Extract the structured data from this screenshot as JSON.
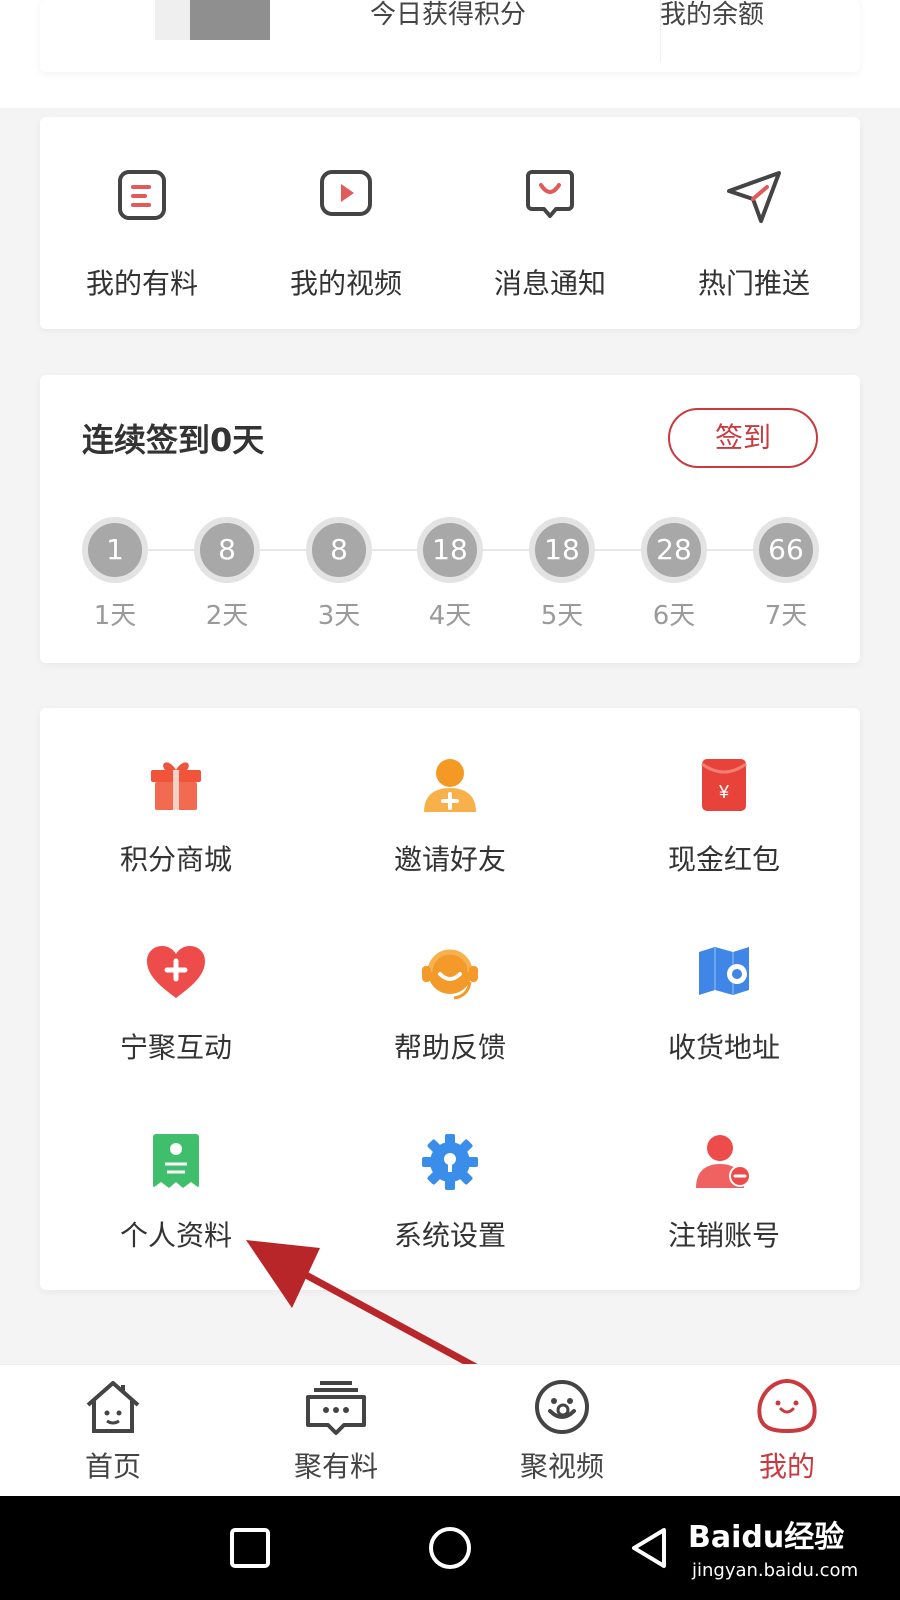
{
  "header": {
    "points_label": "今日获得积分",
    "balance_label": "我的余额"
  },
  "quick_actions": [
    {
      "label": "我的有料",
      "icon": "note-icon"
    },
    {
      "label": "我的视频",
      "icon": "video-play-icon"
    },
    {
      "label": "消息通知",
      "icon": "message-bubble-icon"
    },
    {
      "label": "热门推送",
      "icon": "paper-plane-icon"
    }
  ],
  "signin": {
    "title": "连续签到0天",
    "button_label": "签到",
    "days": [
      {
        "points": "1",
        "label": "1天"
      },
      {
        "points": "8",
        "label": "2天"
      },
      {
        "points": "8",
        "label": "3天"
      },
      {
        "points": "18",
        "label": "4天"
      },
      {
        "points": "18",
        "label": "5天"
      },
      {
        "points": "28",
        "label": "6天"
      },
      {
        "points": "66",
        "label": "7天"
      }
    ]
  },
  "services": [
    {
      "label": "积分商城",
      "icon": "gift-icon"
    },
    {
      "label": "邀请好友",
      "icon": "add-user-icon"
    },
    {
      "label": "现金红包",
      "icon": "red-envelope-icon"
    },
    {
      "label": "宁聚互动",
      "icon": "heart-plus-icon"
    },
    {
      "label": "帮助反馈",
      "icon": "headset-icon"
    },
    {
      "label": "收货地址",
      "icon": "map-pin-icon"
    },
    {
      "label": "个人资料",
      "icon": "profile-card-icon"
    },
    {
      "label": "系统设置",
      "icon": "settings-gear-icon"
    },
    {
      "label": "注销账号",
      "icon": "remove-user-icon"
    }
  ],
  "tabbar": [
    {
      "label": "首页",
      "icon": "home-icon",
      "active": false
    },
    {
      "label": "聚有料",
      "icon": "chat-box-icon",
      "active": false
    },
    {
      "label": "聚视频",
      "icon": "smile-video-icon",
      "active": false
    },
    {
      "label": "我的",
      "icon": "profile-face-icon",
      "active": true
    }
  ],
  "system_nav": {
    "buttons": [
      "recent-apps-icon",
      "home-circle-icon",
      "back-icon"
    ]
  },
  "watermark": {
    "main": "Baidu经验",
    "sub": "jingyan.baidu.com"
  },
  "colors": {
    "accent": "#c9393e",
    "gift": "#f0553c",
    "invite": "#f49a24",
    "envelope": "#e8433a",
    "heart": "#ee4b4b",
    "headset": "#f39a2b",
    "map": "#3f86e6",
    "profile": "#3fbf6b",
    "settings": "#3a8de8",
    "remove_user": "#ee4b4b"
  }
}
